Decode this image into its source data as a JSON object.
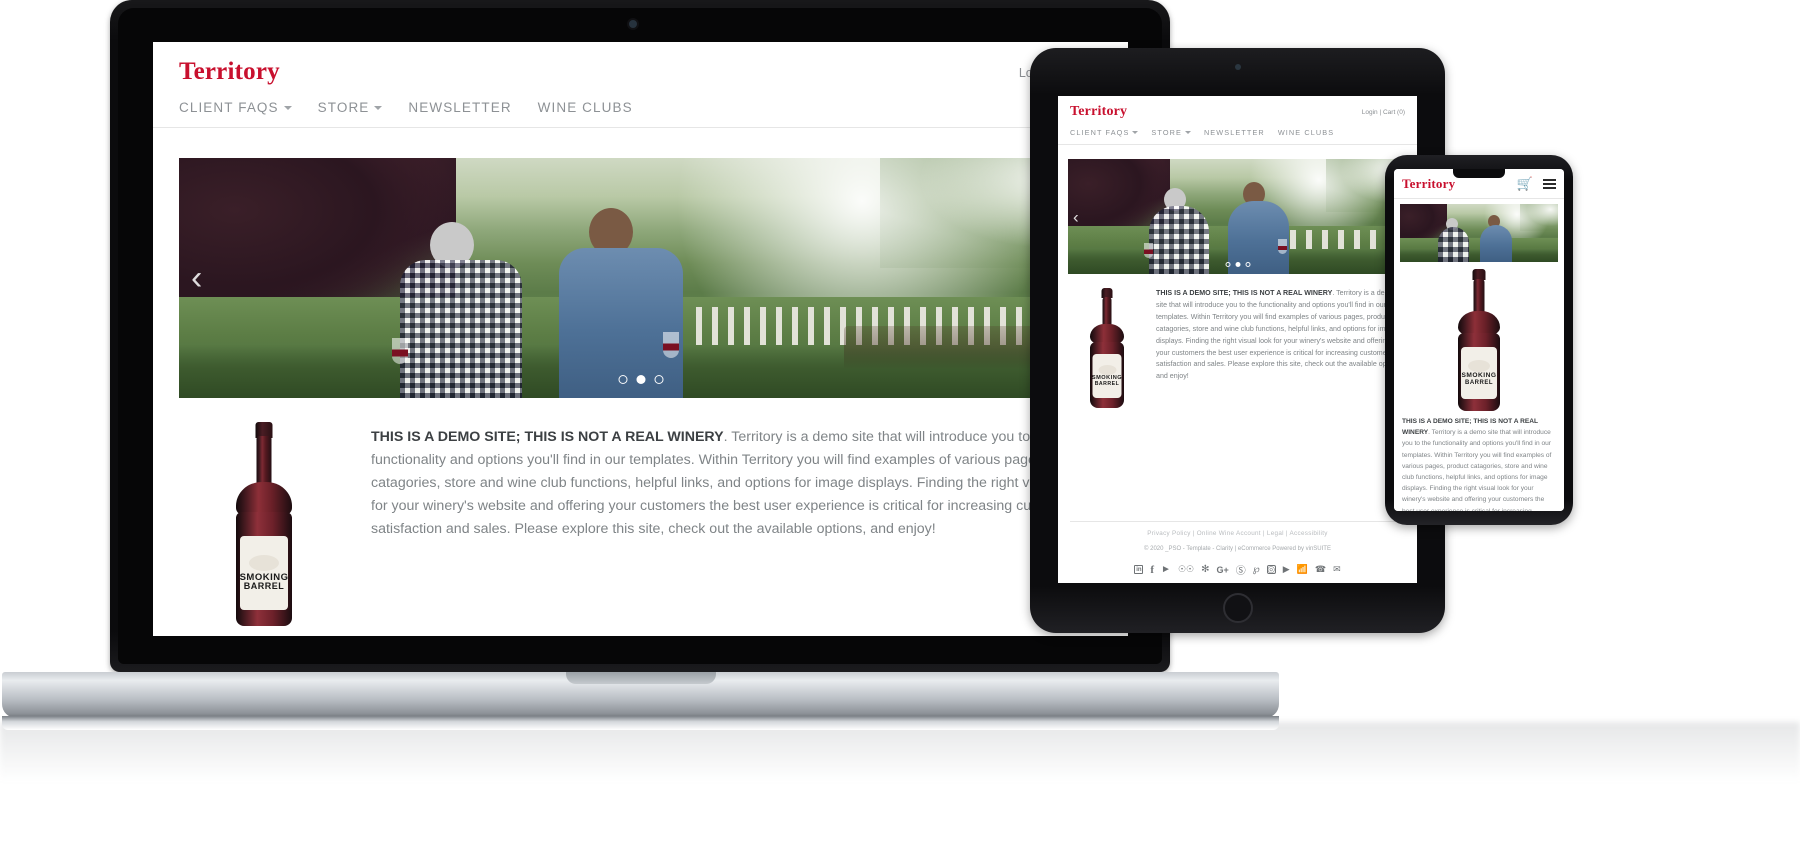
{
  "site": {
    "brand": "Territory",
    "account": {
      "login": "Login",
      "separator": "|",
      "cart": "Cart (0)"
    },
    "nav": [
      {
        "label": "CLIENT FAQS",
        "has_dropdown": true
      },
      {
        "label": "STORE",
        "has_dropdown": true
      },
      {
        "label": "NEWSLETTER",
        "has_dropdown": false
      },
      {
        "label": "WINE CLUBS",
        "has_dropdown": false
      }
    ],
    "hero": {
      "prev_arrow": "‹",
      "next_arrow": "›",
      "slides": 3,
      "active_slide": 2,
      "alt": "Two men tasting red wine in a vineyard"
    },
    "intro": {
      "headline": "THIS IS A DEMO SITE; THIS IS NOT A REAL WINERY",
      "body": ". Territory is a demo site that will introduce you to the functionality and options you'll find in our templates. Within Territory you will find examples of various pages, product catagories, store and wine club functions, helpful links, and options for image displays. Finding the right visual look for your winery's website and offering your customers the best user experience is critical for increasing customer satisfaction and sales. Please explore this site, check out the available options, and enjoy!"
    },
    "bottle": {
      "label_line1": "SMOKING",
      "label_line2": "BARREL",
      "alt": "Red wine bottle with Smoking Barrel label"
    },
    "footer": {
      "links": [
        "Privacy Policy",
        "Online Wine Account",
        "Legal",
        "Accessibility"
      ],
      "separator": "|",
      "copyright": "© 2020 _PSO - Template - Clarity | eCommerce Powered by vinSUITE",
      "social": [
        "linkedin-icon",
        "facebook-icon",
        "twitter-icon",
        "tripadvisor-icon",
        "yelp-icon",
        "googleplus-icon",
        "wordpress-icon",
        "pinterest-icon",
        "instagram-icon",
        "youtube-icon",
        "rss-icon",
        "phone-icon",
        "email-icon"
      ]
    },
    "mobile": {
      "cart_icon": "shopping-cart-icon",
      "menu_icon": "hamburger-menu-icon"
    }
  },
  "colors": {
    "brand_red": "#c8102e",
    "nav_grey": "#8d9195",
    "body_grey": "#7f8487",
    "heading_dark": "#3c4043",
    "device_black": "#0b0b0d",
    "laptop_silver": "#c9cdd2"
  },
  "devices": [
    {
      "name": "laptop",
      "type": "macbook"
    },
    {
      "name": "tablet",
      "type": "ipad"
    },
    {
      "name": "phone",
      "type": "iphone"
    }
  ]
}
